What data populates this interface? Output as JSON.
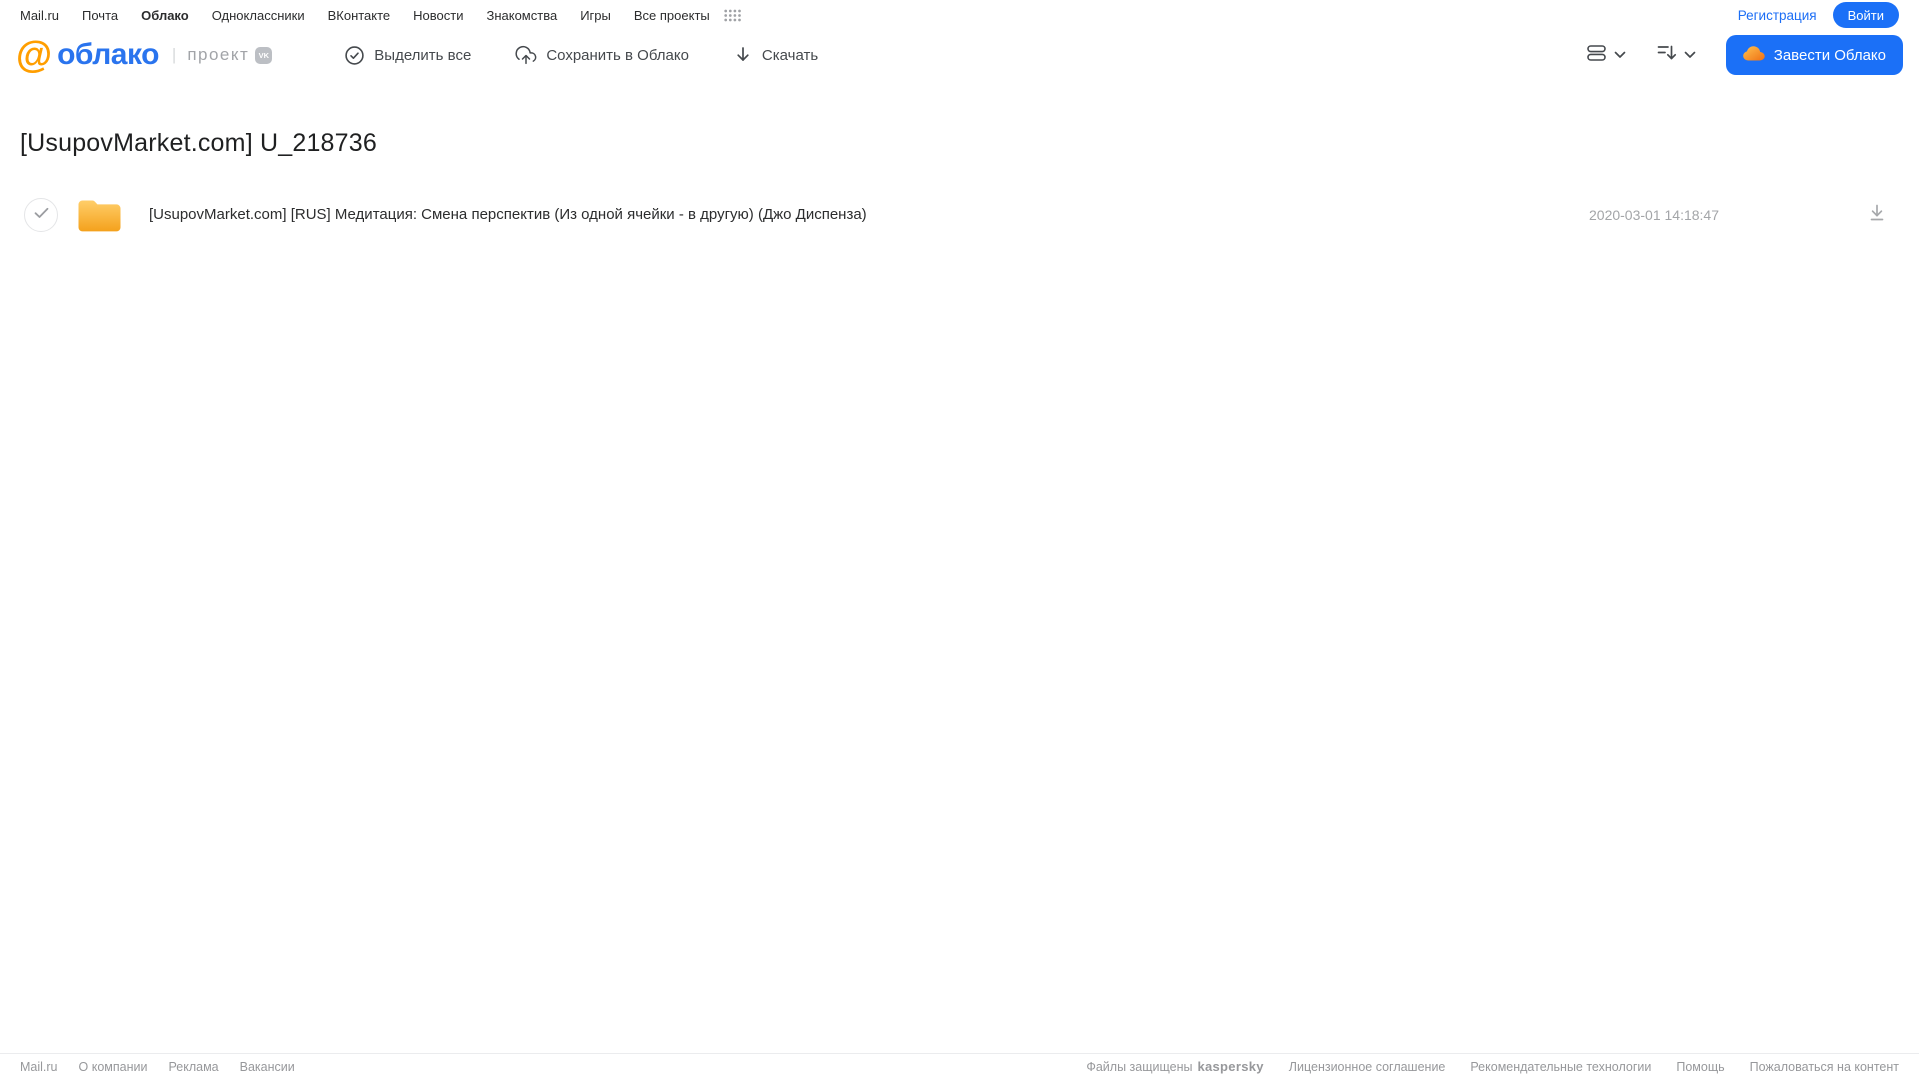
{
  "colors": {
    "accent_blue": "#1b70f7",
    "logo_blue": "#2a74ee",
    "logo_orange": "#ff9e00",
    "folder_orange": "#f5a31d",
    "kaspersky_green": "#00a88e"
  },
  "portal_nav": {
    "items": [
      "Mail.ru",
      "Почта",
      "Облако",
      "Одноклассники",
      "ВКонтакте",
      "Новости",
      "Знакомства",
      "Игры",
      "Все проекты"
    ],
    "registration_label": "Регистрация",
    "login_label": "Войти"
  },
  "header": {
    "logo_at": "@",
    "logo_text": "облако",
    "logo_divider": "|",
    "project_label": "проект",
    "vk_badge": "VK",
    "toolbar": {
      "select_all_label": "Выделить все",
      "save_to_cloud_label": "Сохранить в Облако",
      "download_label": "Скачать"
    },
    "get_cloud_label": "Завести Облако"
  },
  "main": {
    "title": "[UsupovMarket.com] U_218736",
    "files": [
      {
        "type": "folder",
        "name": "[UsupovMarket.com] [RUS] Медитация: Смена перспектив (Из одной ячейки - в другую) (Джо Диспенза)",
        "date": "2020-03-01 14:18:47"
      }
    ]
  },
  "footer": {
    "left_links": [
      "Mail.ru",
      "О компании",
      "Реклама",
      "Вакансии"
    ],
    "protected_by_text": "Файлы защищены",
    "kaspersky_label": "kaspersky",
    "right_links": [
      "Лицензионное соглашение",
      "Рекомендательные технологии",
      "Помощь",
      "Пожаловаться на контент"
    ]
  },
  "icons": {
    "all-projects-grid-icon": "dot-grid",
    "select-all-icon": "check-circle",
    "save-to-cloud-icon": "cloud-upload-arrow",
    "download-icon": "arrow-down",
    "view-mode-icon": "stacked-rows",
    "sort-icon": "lines-arrow-down",
    "chevron-down-icon": "chevron-down",
    "get-cloud-icon": "orange-cloud",
    "folder-icon": "yellow-folder",
    "row-checkbox-icon": "checkmark",
    "row-download-icon": "arrow-down-underline"
  }
}
